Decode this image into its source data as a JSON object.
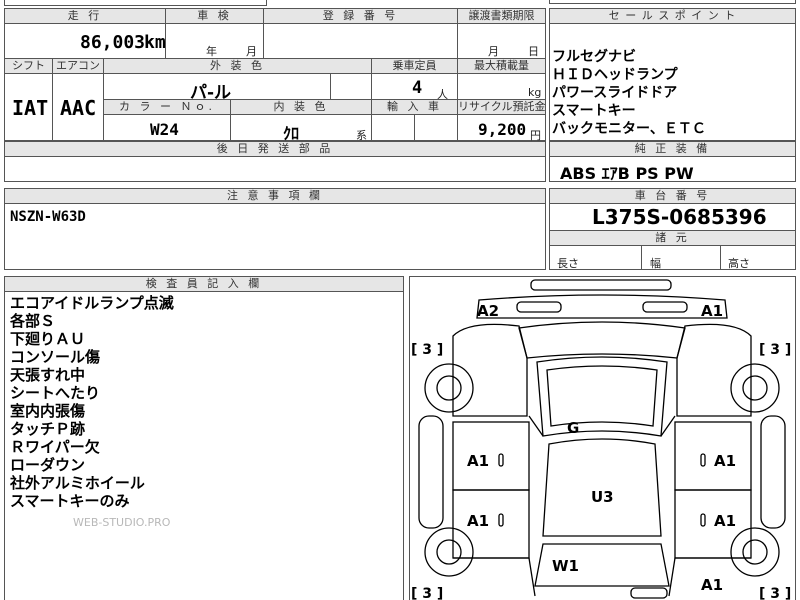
{
  "mileage": {
    "header": "走 行",
    "value": "86,003",
    "unit": "km"
  },
  "inspection": {
    "header": "車 検",
    "year_label": "年",
    "month_label": "月"
  },
  "registration": {
    "header": "登 録 番 号"
  },
  "transfer_deadline": {
    "header": "譲渡書類期限",
    "month_label": "月",
    "day_label": "日"
  },
  "sales_points": {
    "header": "セ ー ル ス ポ イ ン ト",
    "items": [
      "フルセグナビ",
      "ＨＩＤヘッドランプ",
      "パワースライドドア",
      "スマートキー",
      "バックモニター、ＥＴＣ"
    ]
  },
  "shift": {
    "header": "シフト",
    "value": "IAT"
  },
  "aircon": {
    "header": "エアコン",
    "value": "AAC"
  },
  "exterior_color": {
    "header": "外 装 色",
    "value": "パ-ル"
  },
  "capacity": {
    "header": "乗車定員",
    "value": "4",
    "unit": "人"
  },
  "max_load": {
    "header": "最大積載量",
    "unit": "kg"
  },
  "color_no": {
    "header": "カ ラ ー Ｎｏ.",
    "value": "W24"
  },
  "interior_color": {
    "header": "内 装 色",
    "value": "ｸﾛ",
    "suffix": "系"
  },
  "import": {
    "header": "輸 入 車"
  },
  "recycle": {
    "header": "リサイクル預託金",
    "value": "9,200",
    "unit": "円"
  },
  "later_parts": {
    "header": "後 日 発 送 部 品"
  },
  "genuine_equipment": {
    "header": "純 正 装 備",
    "value": "ABS ｴｱB PS PW"
  },
  "notes": {
    "header": "注 意 事 項 欄",
    "value": "NSZN-W63D"
  },
  "chassis": {
    "header": "車 台 番 号",
    "value": "L375S-0685396"
  },
  "specs": {
    "header": "諸 元",
    "length_label": "長さ",
    "width_label": "幅",
    "height_label": "高さ"
  },
  "inspector": {
    "header": "検 査 員 記 入 欄",
    "lines": [
      "エコアイドルランプ点滅",
      "各部Ｓ",
      "下廻りＡＵ",
      "コンソール傷",
      "天張すれ中",
      "シートへたり",
      "室内内張傷",
      "タッチＰ跡",
      "Ｒワイパー欠",
      "ローダウン",
      "社外アルミホイール",
      "スマートキーのみ"
    ]
  },
  "watermark": "WEB-STUDIO.PRO",
  "car_map": {
    "marks": {
      "front_left": "A2",
      "front_right": "A1",
      "tire_fl": "[ 3 ]",
      "tire_fr": "[ 3 ]",
      "tire_rl": "[ 3 ]",
      "tire_rr": "[ 3 ]",
      "windshield": "G",
      "door_lf": "A1",
      "door_rf": "A1",
      "door_lr": "A1",
      "door_rr": "A1",
      "roof": "U3",
      "rear_glass": "W1",
      "rear_right": "A1"
    }
  }
}
